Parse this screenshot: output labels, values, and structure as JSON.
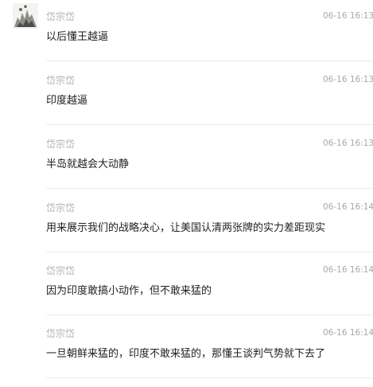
{
  "comments": [
    {
      "username": "岱宗岱",
      "time": "06-16 16:13:",
      "content": "以后懂王越逼"
    },
    {
      "username": "岱宗岱",
      "time": "06-16 16:13:",
      "content": "印度越逼"
    },
    {
      "username": "岱宗岱",
      "time": "06-16 16:13:",
      "content": "半岛就越会大动静"
    },
    {
      "username": "岱宗岱",
      "time": "06-16 16:14:",
      "content": "用来展示我们的战略决心，让美国认清两张牌的实力差距现实"
    },
    {
      "username": "岱宗岱",
      "time": "06-16 16:14:",
      "content": "因为印度敢搞小动作，但不敢来猛的"
    },
    {
      "username": "岱宗岱",
      "time": "06-16 16:14:",
      "content": "一旦朝鲜来猛的，印度不敢来猛的，那懂王谈判气势就下去了"
    }
  ]
}
